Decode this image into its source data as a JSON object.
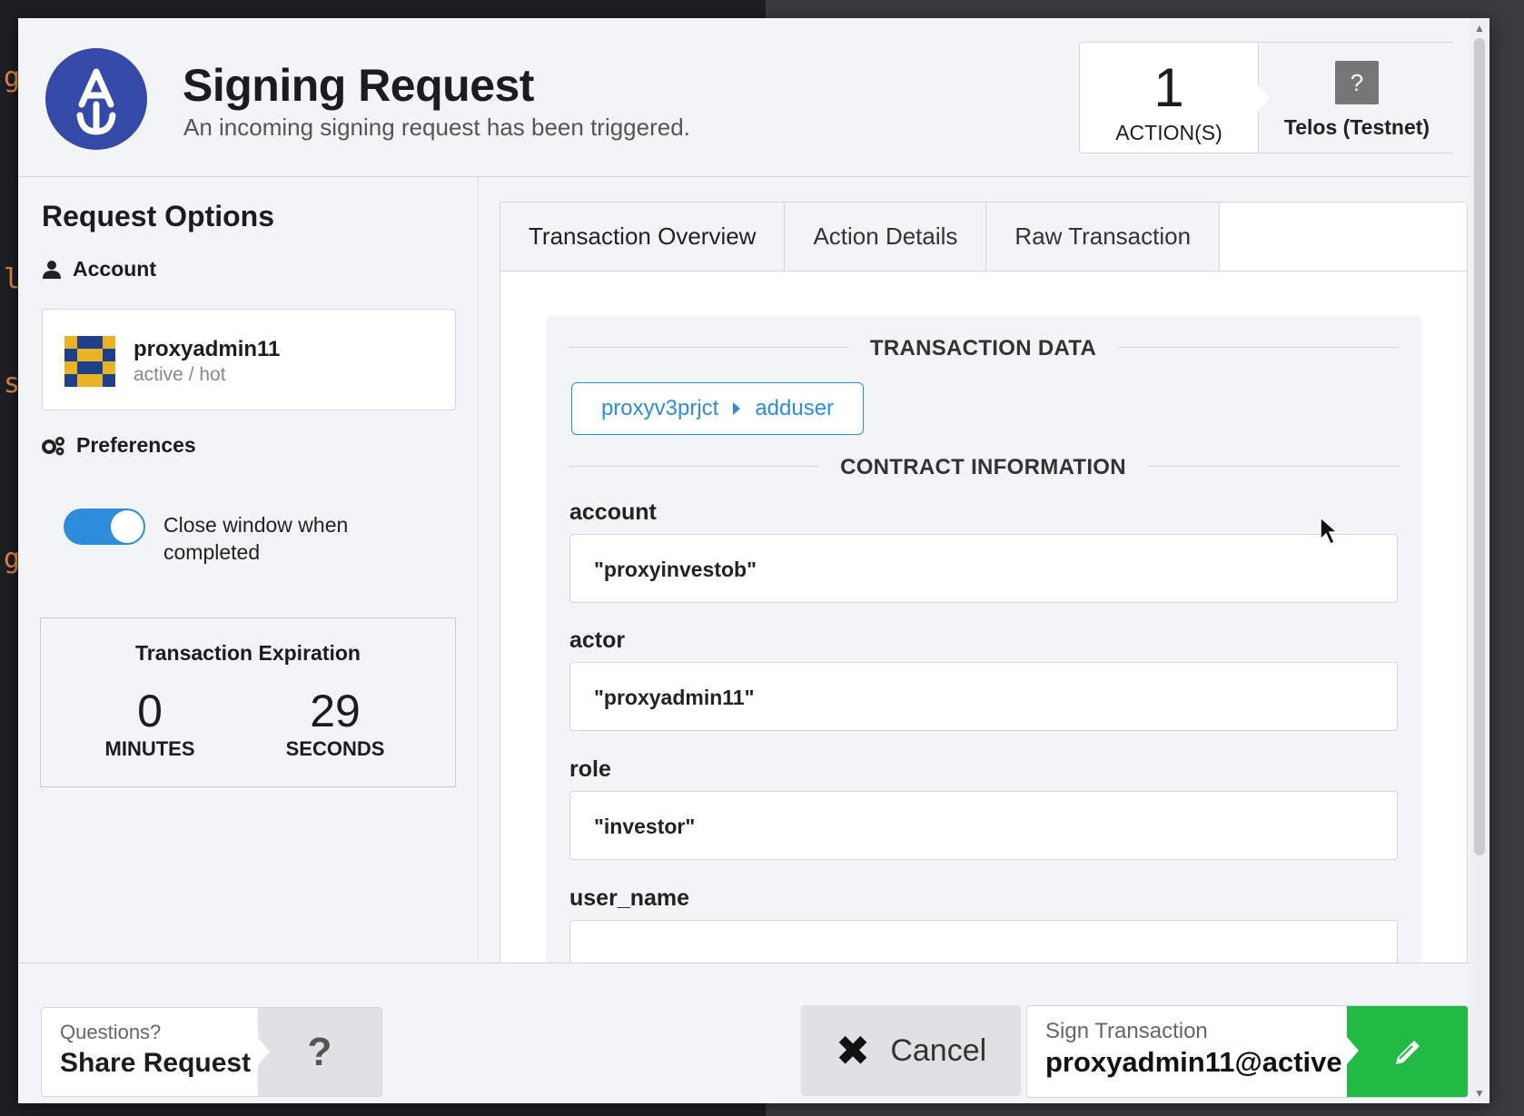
{
  "header": {
    "title": "Signing Request",
    "subtitle": "An incoming signing request has been triggered.",
    "actions_count": "1",
    "actions_label": "ACTION(S)",
    "network_icon": "?",
    "network_name": "Telos (Testnet)"
  },
  "sidebar": {
    "title": "Request Options",
    "account_label": "Account",
    "account_name": "proxyadmin11",
    "account_permission": "active / hot",
    "preferences_label": "Preferences",
    "close_window_label": "Close window when completed",
    "close_window_enabled": true,
    "expiration": {
      "title": "Transaction Expiration",
      "minutes": "0",
      "minutes_label": "MINUTES",
      "seconds": "29",
      "seconds_label": "SECONDS"
    }
  },
  "tabs": [
    {
      "label": "Transaction Overview",
      "active": true
    },
    {
      "label": "Action Details",
      "active": false
    },
    {
      "label": "Raw Transaction",
      "active": false
    }
  ],
  "transaction": {
    "data_heading": "TRANSACTION DATA",
    "contract": "proxyv3prjct",
    "action": "adduser",
    "info_heading": "CONTRACT INFORMATION",
    "fields": [
      {
        "label": "account",
        "value": "\"proxyinvestob\""
      },
      {
        "label": "actor",
        "value": "\"proxyadmin11\""
      },
      {
        "label": "role",
        "value": "\"investor\""
      },
      {
        "label": "user_name",
        "value": ""
      }
    ]
  },
  "footer": {
    "share_small": "Questions?",
    "share_big": "Share Request",
    "help_icon": "?",
    "cancel_label": "Cancel",
    "sign_small": "Sign Transaction",
    "sign_big": "proxyadmin11@active"
  },
  "background_code": [
    "g",
    "l",
    "s",
    "g"
  ],
  "colors": {
    "accent_blue": "#2d8ddb",
    "logo_blue": "#3549a8",
    "sign_green": "#21ba45"
  }
}
